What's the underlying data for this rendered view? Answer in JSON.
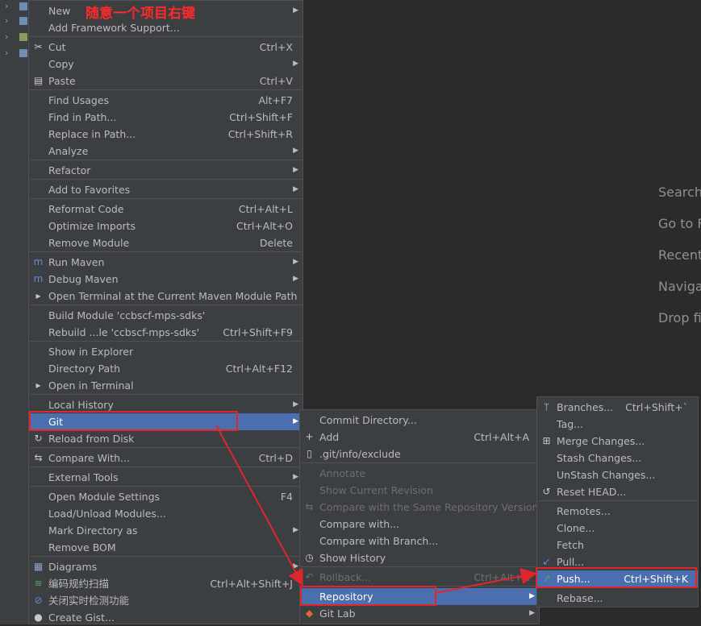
{
  "welcome": {
    "search": "Search",
    "goto": "Go to F",
    "recent": "Recent",
    "navigate": "Naviga",
    "drop": "Drop fi"
  },
  "annotation": "随意一个项目右键",
  "context_menu": [
    {
      "label": "New",
      "submenu": true
    },
    {
      "label": "Add Framework Support..."
    },
    {
      "label": "Cut",
      "shortcut": "Ctrl+X",
      "icon": "scissors-icon"
    },
    {
      "label": "Copy",
      "submenu": true
    },
    {
      "label": "Paste",
      "shortcut": "Ctrl+V",
      "icon": "clipboard-icon"
    },
    {
      "label": "Find Usages",
      "shortcut": "Alt+F7"
    },
    {
      "label": "Find in Path...",
      "shortcut": "Ctrl+Shift+F"
    },
    {
      "label": "Replace in Path...",
      "shortcut": "Ctrl+Shift+R"
    },
    {
      "label": "Analyze",
      "submenu": true
    },
    {
      "label": "Refactor",
      "submenu": true
    },
    {
      "label": "Add to Favorites",
      "submenu": true
    },
    {
      "label": "Reformat Code",
      "shortcut": "Ctrl+Alt+L"
    },
    {
      "label": "Optimize Imports",
      "shortcut": "Ctrl+Alt+O"
    },
    {
      "label": "Remove Module",
      "shortcut": "Delete"
    },
    {
      "label": "Run Maven",
      "submenu": true,
      "icon": "maven-icon"
    },
    {
      "label": "Debug Maven",
      "submenu": true,
      "icon": "maven-icon"
    },
    {
      "label": "Open Terminal at the Current Maven Module Path",
      "icon": "terminal-icon"
    },
    {
      "label": "Build Module 'ccbscf-mps-sdks'"
    },
    {
      "label": "Rebuild ...le 'ccbscf-mps-sdks'",
      "shortcut": "Ctrl+Shift+F9"
    },
    {
      "label": "Show in Explorer"
    },
    {
      "label": "Directory Path",
      "shortcut": "Ctrl+Alt+F12"
    },
    {
      "label": "Open in Terminal",
      "icon": "terminal-icon"
    },
    {
      "label": "Local History",
      "submenu": true
    },
    {
      "label": "Git",
      "submenu": true,
      "selected": true
    },
    {
      "label": "Reload from Disk",
      "icon": "reload-icon"
    },
    {
      "label": "Compare With...",
      "shortcut": "Ctrl+D",
      "icon": "compare-icon"
    },
    {
      "label": "External Tools",
      "submenu": true
    },
    {
      "label": "Open Module Settings",
      "shortcut": "F4"
    },
    {
      "label": "Load/Unload Modules..."
    },
    {
      "label": "Mark Directory as",
      "submenu": true
    },
    {
      "label": "Remove BOM"
    },
    {
      "label": "Diagrams",
      "submenu": true,
      "icon": "diagram-icon"
    },
    {
      "label": "编码规约扫描",
      "shortcut": "Ctrl+Alt+Shift+J",
      "icon": "scan-icon"
    },
    {
      "label": "关闭实时检测功能",
      "icon": "block-icon"
    },
    {
      "label": "Create Gist...",
      "icon": "github-icon"
    }
  ],
  "git_menu": [
    {
      "label": "Commit Directory..."
    },
    {
      "label": "Add",
      "shortcut": "Ctrl+Alt+A",
      "icon": "plus-icon"
    },
    {
      "label": ".git/info/exclude",
      "icon": "file-icon"
    },
    {
      "label": "Annotate",
      "disabled": true
    },
    {
      "label": "Show Current Revision",
      "disabled": true
    },
    {
      "label": "Compare with the Same Repository Version",
      "disabled": true,
      "icon": "compare-icon"
    },
    {
      "label": "Compare with..."
    },
    {
      "label": "Compare with Branch..."
    },
    {
      "label": "Show History",
      "icon": "clock-icon"
    },
    {
      "label": "Rollback...",
      "shortcut": "Ctrl+Alt+Z",
      "disabled": true,
      "icon": "rollback-icon"
    },
    {
      "label": "Repository",
      "submenu": true,
      "selected": true
    },
    {
      "label": "Git Lab",
      "submenu": true,
      "icon": "gitlab-icon"
    }
  ],
  "repository_menu": [
    {
      "label": "Branches...",
      "shortcut": "Ctrl+Shift+`",
      "icon": "branch-icon"
    },
    {
      "label": "Tag..."
    },
    {
      "label": "Merge Changes...",
      "icon": "merge-icon"
    },
    {
      "label": "Stash Changes..."
    },
    {
      "label": "UnStash Changes..."
    },
    {
      "label": "Reset HEAD...",
      "icon": "reset-icon"
    },
    {
      "label": "Remotes..."
    },
    {
      "label": "Clone..."
    },
    {
      "label": "Fetch"
    },
    {
      "label": "Pull...",
      "icon": "pull-icon"
    },
    {
      "label": "Push...",
      "shortcut": "Ctrl+Shift+K",
      "selected": true,
      "icon": "push-icon"
    },
    {
      "label": "Rebase..."
    }
  ]
}
